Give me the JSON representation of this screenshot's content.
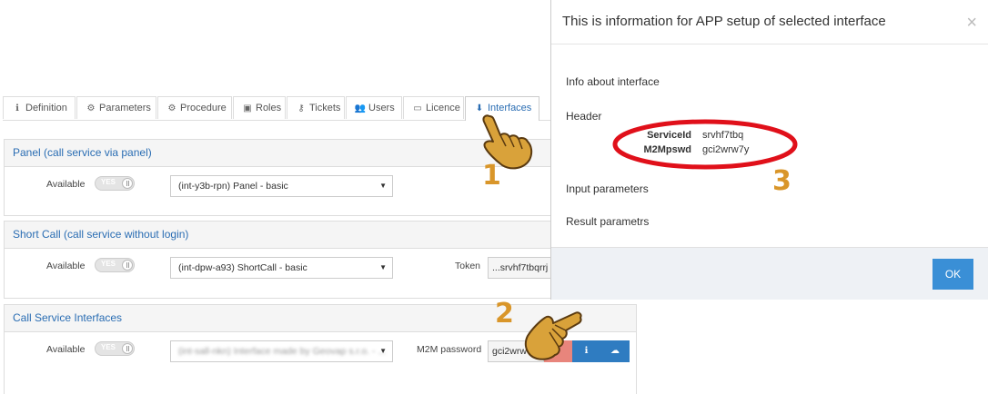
{
  "tabs": [
    {
      "label": "Definition",
      "icon": "info-icon",
      "glyph": "ℹ"
    },
    {
      "label": "Parameters",
      "icon": "gear-icon",
      "glyph": "⚙"
    },
    {
      "label": "Procedure",
      "icon": "cogs-icon",
      "glyph": "⚙"
    },
    {
      "label": "Roles",
      "icon": "briefcase-icon",
      "glyph": "▣"
    },
    {
      "label": "Tickets",
      "icon": "key-icon",
      "glyph": "⚷"
    },
    {
      "label": "Users",
      "icon": "users-icon",
      "glyph": "👥"
    },
    {
      "label": "Licence",
      "icon": "card-icon",
      "glyph": "▭"
    },
    {
      "label": "Interfaces",
      "icon": "download-icon",
      "glyph": "⬇"
    }
  ],
  "active_tab": "Interfaces",
  "panels": {
    "panel": {
      "title": "Panel (call service via panel)",
      "available_label": "Available",
      "toggle_text": "YES",
      "select_value": "(int-y3b-rpn) Panel - basic"
    },
    "shortcall": {
      "title": "Short Call (call service without login)",
      "available_label": "Available",
      "toggle_text": "YES",
      "select_value": "(int-dpw-a93) ShortCall - basic",
      "token_label": "Token",
      "token_value": "...srvhf7tbqrrj"
    },
    "callservice": {
      "title": "Call Service Interfaces",
      "available_label": "Available",
      "toggle_text": "YES",
      "select_value": "(int-sall-nkn) Interface made by Geovap s.r.o. - ...",
      "m2m_label": "M2M password",
      "m2m_value": "gci2wrw7y",
      "info_icon": "info-circle-icon",
      "download_icon": "cloud-download-icon"
    }
  },
  "modal": {
    "title": "This is information for APP setup of selected interface",
    "close_glyph": "×",
    "info_about": "Info about interface",
    "header_label": "Header",
    "header_rows": [
      {
        "key": "ServiceId",
        "value": "srvhf7tbq"
      },
      {
        "key": "M2Mpswd",
        "value": "gci2wrw7y"
      }
    ],
    "input_parameters": "Input parameters",
    "result_parameters": "Result parametrs",
    "ok_label": "OK"
  },
  "callouts": {
    "one": "1",
    "two": "2",
    "three": "3"
  },
  "colors": {
    "accent": "#2a6db3",
    "ok_button": "#3a8fd6",
    "callout": "#d9962a",
    "highlight_ellipse": "#e0101a",
    "danger_button": "#e8857c"
  }
}
